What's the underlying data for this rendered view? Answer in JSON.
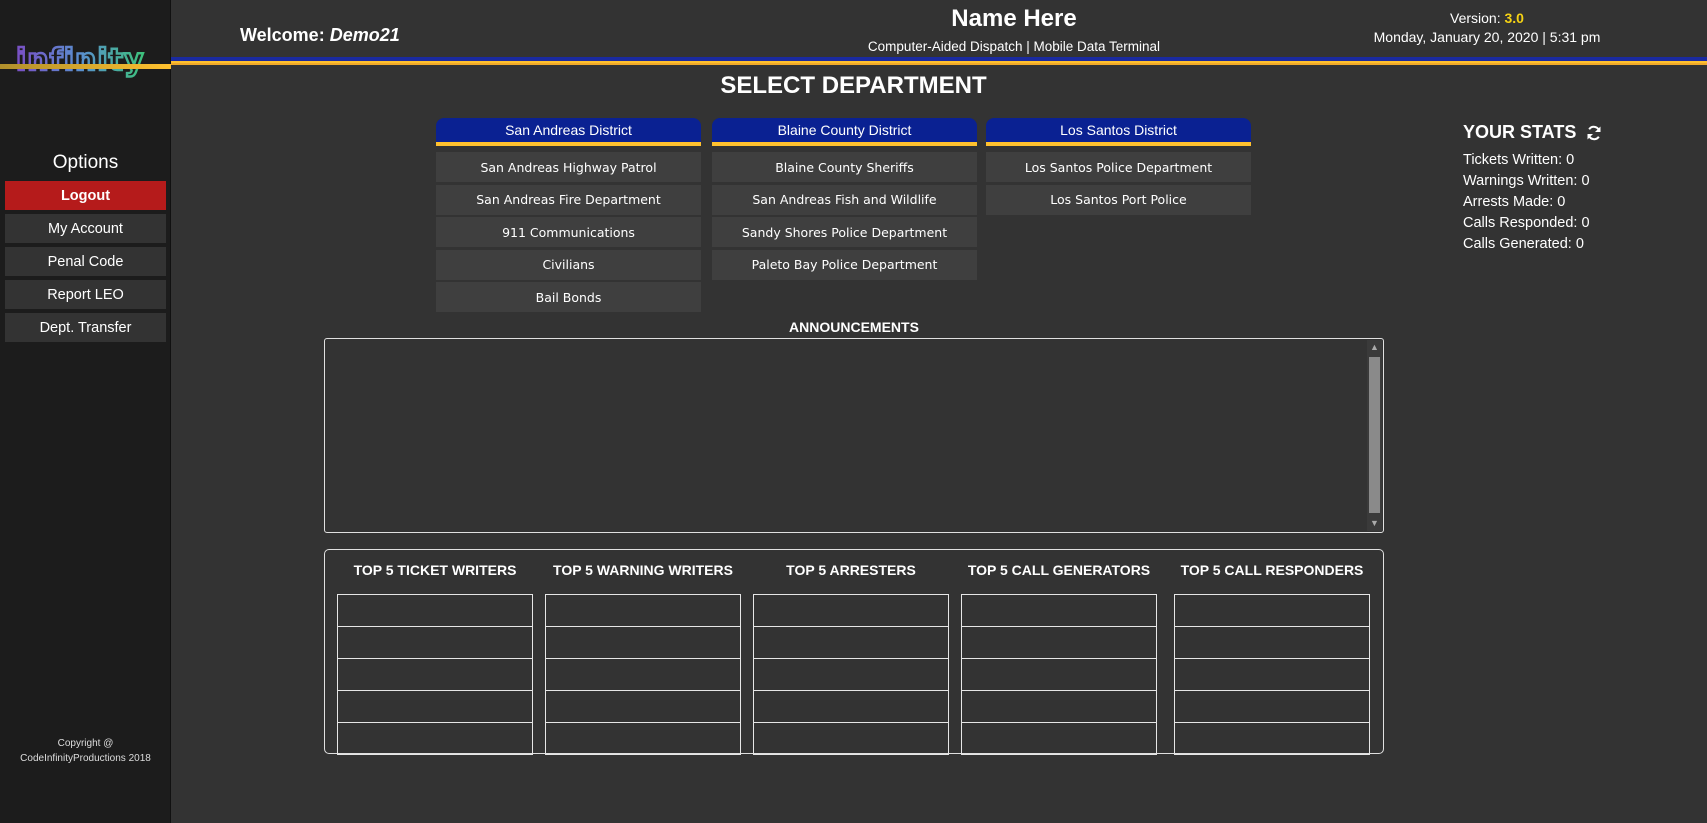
{
  "sidebar": {
    "logo_text": "infinity",
    "options_title": "Options",
    "menu": [
      {
        "label": "Logout",
        "name": "logout-button"
      },
      {
        "label": "My Account",
        "name": "my-account-button"
      },
      {
        "label": "Penal Code",
        "name": "penal-code-button"
      },
      {
        "label": "Report LEO",
        "name": "report-leo-button"
      },
      {
        "label": "Dept. Transfer",
        "name": "dept-transfer-button"
      }
    ],
    "copyright_line1": "Copyright @",
    "copyright_line2": "CodeInfinityProductions 2018"
  },
  "header": {
    "welcome_label": "Welcome:",
    "username": "Demo21",
    "app_name": "Name Here",
    "subtitle": "Computer-Aided Dispatch | Mobile Data Terminal",
    "version_label": "Version:",
    "version": "3.0",
    "datetime": "Monday, January 20, 2020 | 5:31 pm"
  },
  "main": {
    "title": "SELECT DEPARTMENT",
    "districts": [
      {
        "name": "San Andreas District",
        "departments": [
          "San Andreas Highway Patrol",
          "San Andreas Fire Department",
          "911 Communications",
          "Civilians",
          "Bail Bonds"
        ]
      },
      {
        "name": "Blaine County District",
        "departments": [
          "Blaine County Sheriffs",
          "San Andreas Fish and Wildlife",
          "Sandy Shores Police Department",
          "Paleto Bay Police Department"
        ]
      },
      {
        "name": "Los Santos District",
        "departments": [
          "Los Santos Police Department",
          "Los Santos Port Police"
        ]
      }
    ],
    "announcements_title": "ANNOUNCEMENTS"
  },
  "stats": {
    "title": "YOUR STATS",
    "items": [
      "Tickets Written: 0",
      "Warnings Written: 0",
      "Arrests Made: 0",
      "Calls Responded: 0",
      "Calls Generated: 0"
    ]
  },
  "leaderboards": [
    {
      "title": "TOP 5 TICKET WRITERS"
    },
    {
      "title": "TOP 5 WARNING WRITERS"
    },
    {
      "title": "TOP 5 ARRESTERS"
    },
    {
      "title": "TOP 5 CALL GENERATORS"
    },
    {
      "title": "TOP 5 CALL RESPONDERS"
    }
  ],
  "colors": {
    "accent_gold": "#ffc12e",
    "district_blue": "#0a2192",
    "logout_red": "#b51b1b",
    "version_yellow": "#f5d214"
  }
}
